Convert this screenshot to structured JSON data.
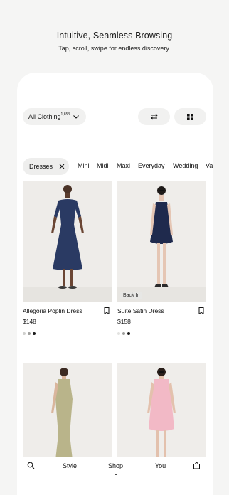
{
  "hero": {
    "title": "Intuitive, Seamless Browsing",
    "subtitle": "Tap, scroll, swipe for endless discovery."
  },
  "filter": {
    "category_label": "All Clothing",
    "category_count": "1,653",
    "sort_icon": "sliders-icon",
    "view_icon": "grid-icon"
  },
  "chips": {
    "active": "Dresses",
    "items": [
      "Mini",
      "Midi",
      "Maxi",
      "Everyday",
      "Wedding",
      "Va"
    ]
  },
  "products": [
    {
      "name": "Allegoria Poplin Dress",
      "price": "$148",
      "badge": "",
      "dress_color": "#2a3a63",
      "swatches": [
        "#cfcfcd",
        "#9d9d9b",
        "#1a1a1a"
      ]
    },
    {
      "name": "Suite Satin Dress",
      "price": "$158",
      "badge": "Back In",
      "dress_color": "#1f2a4d",
      "swatches": [
        "#e2e2e0",
        "#9d9d9b",
        "#1a1a1a"
      ]
    },
    {
      "name": "",
      "price": "",
      "badge": "",
      "dress_color": "#b9b48a",
      "swatches": []
    },
    {
      "name": "",
      "price": "",
      "badge": "",
      "dress_color": "#f2b9c6",
      "swatches": []
    }
  ],
  "tabbar": {
    "search_icon": "search-icon",
    "style": "Style",
    "shop": "Shop",
    "you": "You",
    "bag_icon": "bag-icon",
    "active": "Shop"
  }
}
